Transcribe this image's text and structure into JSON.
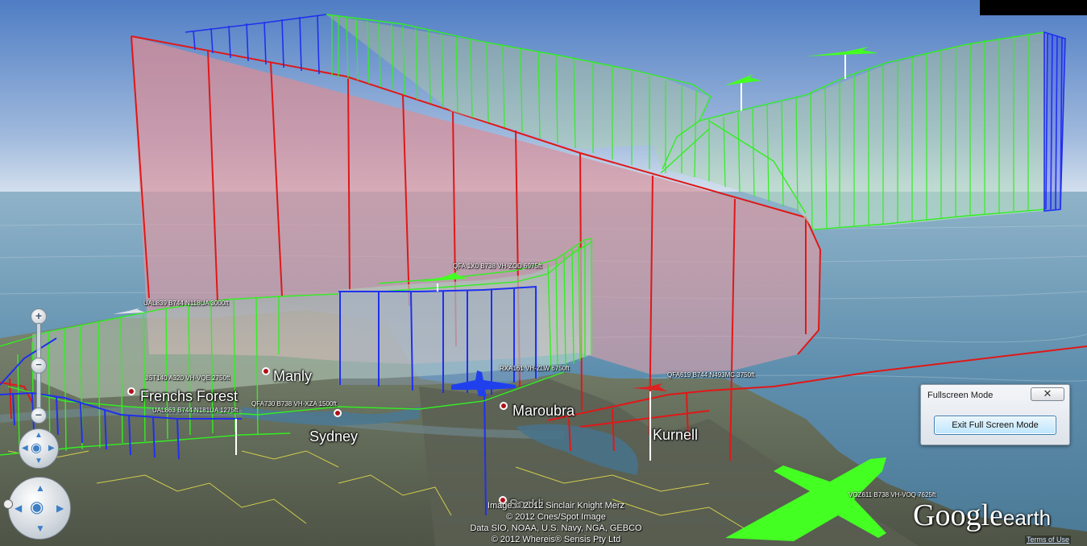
{
  "app": {
    "logo_google": "Google",
    "logo_earth": "earth",
    "terms_link": "Terms of Use"
  },
  "places": [
    {
      "name": "Manly"
    },
    {
      "name": "Frenchs Forest"
    },
    {
      "name": "Sydney"
    },
    {
      "name": "Maroubra"
    },
    {
      "name": "Kurnell"
    },
    {
      "name": "Sockli"
    }
  ],
  "flights": [
    {
      "label": "QFA 1X0 B738 VH-ZOD 6975ft",
      "color": "#33ee22"
    },
    {
      "label": "UAL839 B744 N118UA 3000ft",
      "color": "#33ee22"
    },
    {
      "label": "JST140 A320 VH-VQE 2750ft",
      "color": "#33ee22"
    },
    {
      "label": "UAL863 B744 N181UA 1275ft",
      "color": "#2030ee"
    },
    {
      "label": "QFA730 B738 VH-XZA 1500ft",
      "color": "#33ee22"
    },
    {
      "label": "RXA161 VH-ZLW 6750ft",
      "color": "#2030ee"
    },
    {
      "label": "QFA619 B744 N493MC 3750ft",
      "color": "#ee2020"
    },
    {
      "label": "VOZ611 B738 VH-VOQ 7625ft",
      "color": "#33ee22"
    }
  ],
  "attribution": [
    "Image © 2012 Sinclair Knight Merz",
    "© 2012 Cnes/Spot Image",
    "Data SIO, NOAA, U.S. Navy, NGA, GEBCO",
    "© 2012 Whereis® Sensis Pty Ltd"
  ],
  "fullscreen_dialog": {
    "title": "Fullscreen Mode",
    "close_glyph": "✕",
    "button_label": "Exit Full Screen Mode"
  },
  "nav": {
    "zoom_in": "+",
    "zoom_out": "−",
    "slider_glyph": "−"
  },
  "colors": {
    "sky_top": "#5a85c8",
    "sky_horizon": "#c8d8ea",
    "sea": "#6f9bb6",
    "track_green": "#33ee22",
    "track_blue": "#2030ee",
    "track_red": "#ee2020",
    "aircraft_icon": "#44ff22"
  }
}
